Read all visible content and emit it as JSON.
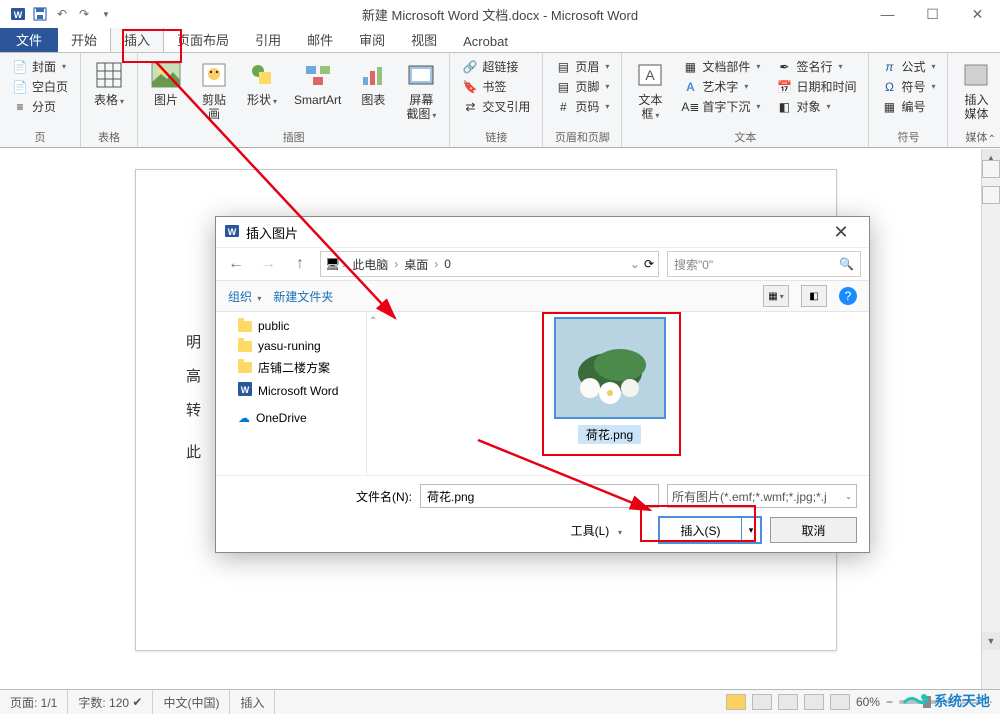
{
  "title": "新建 Microsoft Word 文档.docx - Microsoft Word",
  "tabs": {
    "file": "文件",
    "home": "开始",
    "insert": "插入",
    "pagelayout": "页面布局",
    "references": "引用",
    "mailings": "邮件",
    "review": "审阅",
    "view": "视图",
    "acrobat": "Acrobat"
  },
  "ribbon": {
    "pages": {
      "cover": "封面",
      "blank": "空白页",
      "break": "分页",
      "label": "页"
    },
    "tables": {
      "table": "表格",
      "label": "表格"
    },
    "illus": {
      "picture": "图片",
      "clipart": "剪贴画",
      "shapes": "形状",
      "smartart": "SmartArt",
      "chart": "图表",
      "screenshot": "屏幕截图",
      "label": "插图"
    },
    "links": {
      "hyperlink": "超链接",
      "bookmark": "书签",
      "crossref": "交叉引用",
      "label": "链接"
    },
    "header": {
      "header": "页眉",
      "footer": "页脚",
      "pagenum": "页码",
      "label": "页眉和页脚"
    },
    "text": {
      "textbox": "文本框",
      "quickparts": "文档部件",
      "wordart": "艺术字",
      "dropcap": "首字下沉",
      "signature": "签名行",
      "datetime": "日期和时间",
      "object": "对象",
      "label": "文本"
    },
    "symbols": {
      "equation": "公式",
      "symbol": "符号",
      "number": "编号",
      "label": "符号"
    },
    "media": {
      "media": "插入媒体",
      "label": "媒体"
    }
  },
  "doc_text": {
    "l1": "明",
    "l2": "高",
    "l3": "转",
    "l4": "此"
  },
  "dialog": {
    "title": "插入图片",
    "breadcrumb": {
      "b1": "此电脑",
      "b2": "桌面",
      "b3": "0"
    },
    "search_ph": "搜索\"0\"",
    "toolbar": {
      "org": "组织",
      "newfolder": "新建文件夹"
    },
    "sidebar": {
      "public": "public",
      "yasu": "yasu-runing",
      "shop": "店铺二楼方案",
      "word": "Microsoft Word",
      "onedrive": "OneDrive"
    },
    "file": {
      "name": "荷花.png"
    },
    "filename_label": "文件名(N):",
    "filename_value": "荷花.png",
    "filetype": "所有图片(*.emf;*.wmf;*.jpg;*.j",
    "tools": "工具(L)",
    "insert_btn": "插入(S)",
    "cancel_btn": "取消"
  },
  "status": {
    "page": "页面: 1/1",
    "words": "字数: 120",
    "lang": "中文(中国)",
    "mode": "插入",
    "zoom": "60%"
  },
  "watermark": "系统天地"
}
